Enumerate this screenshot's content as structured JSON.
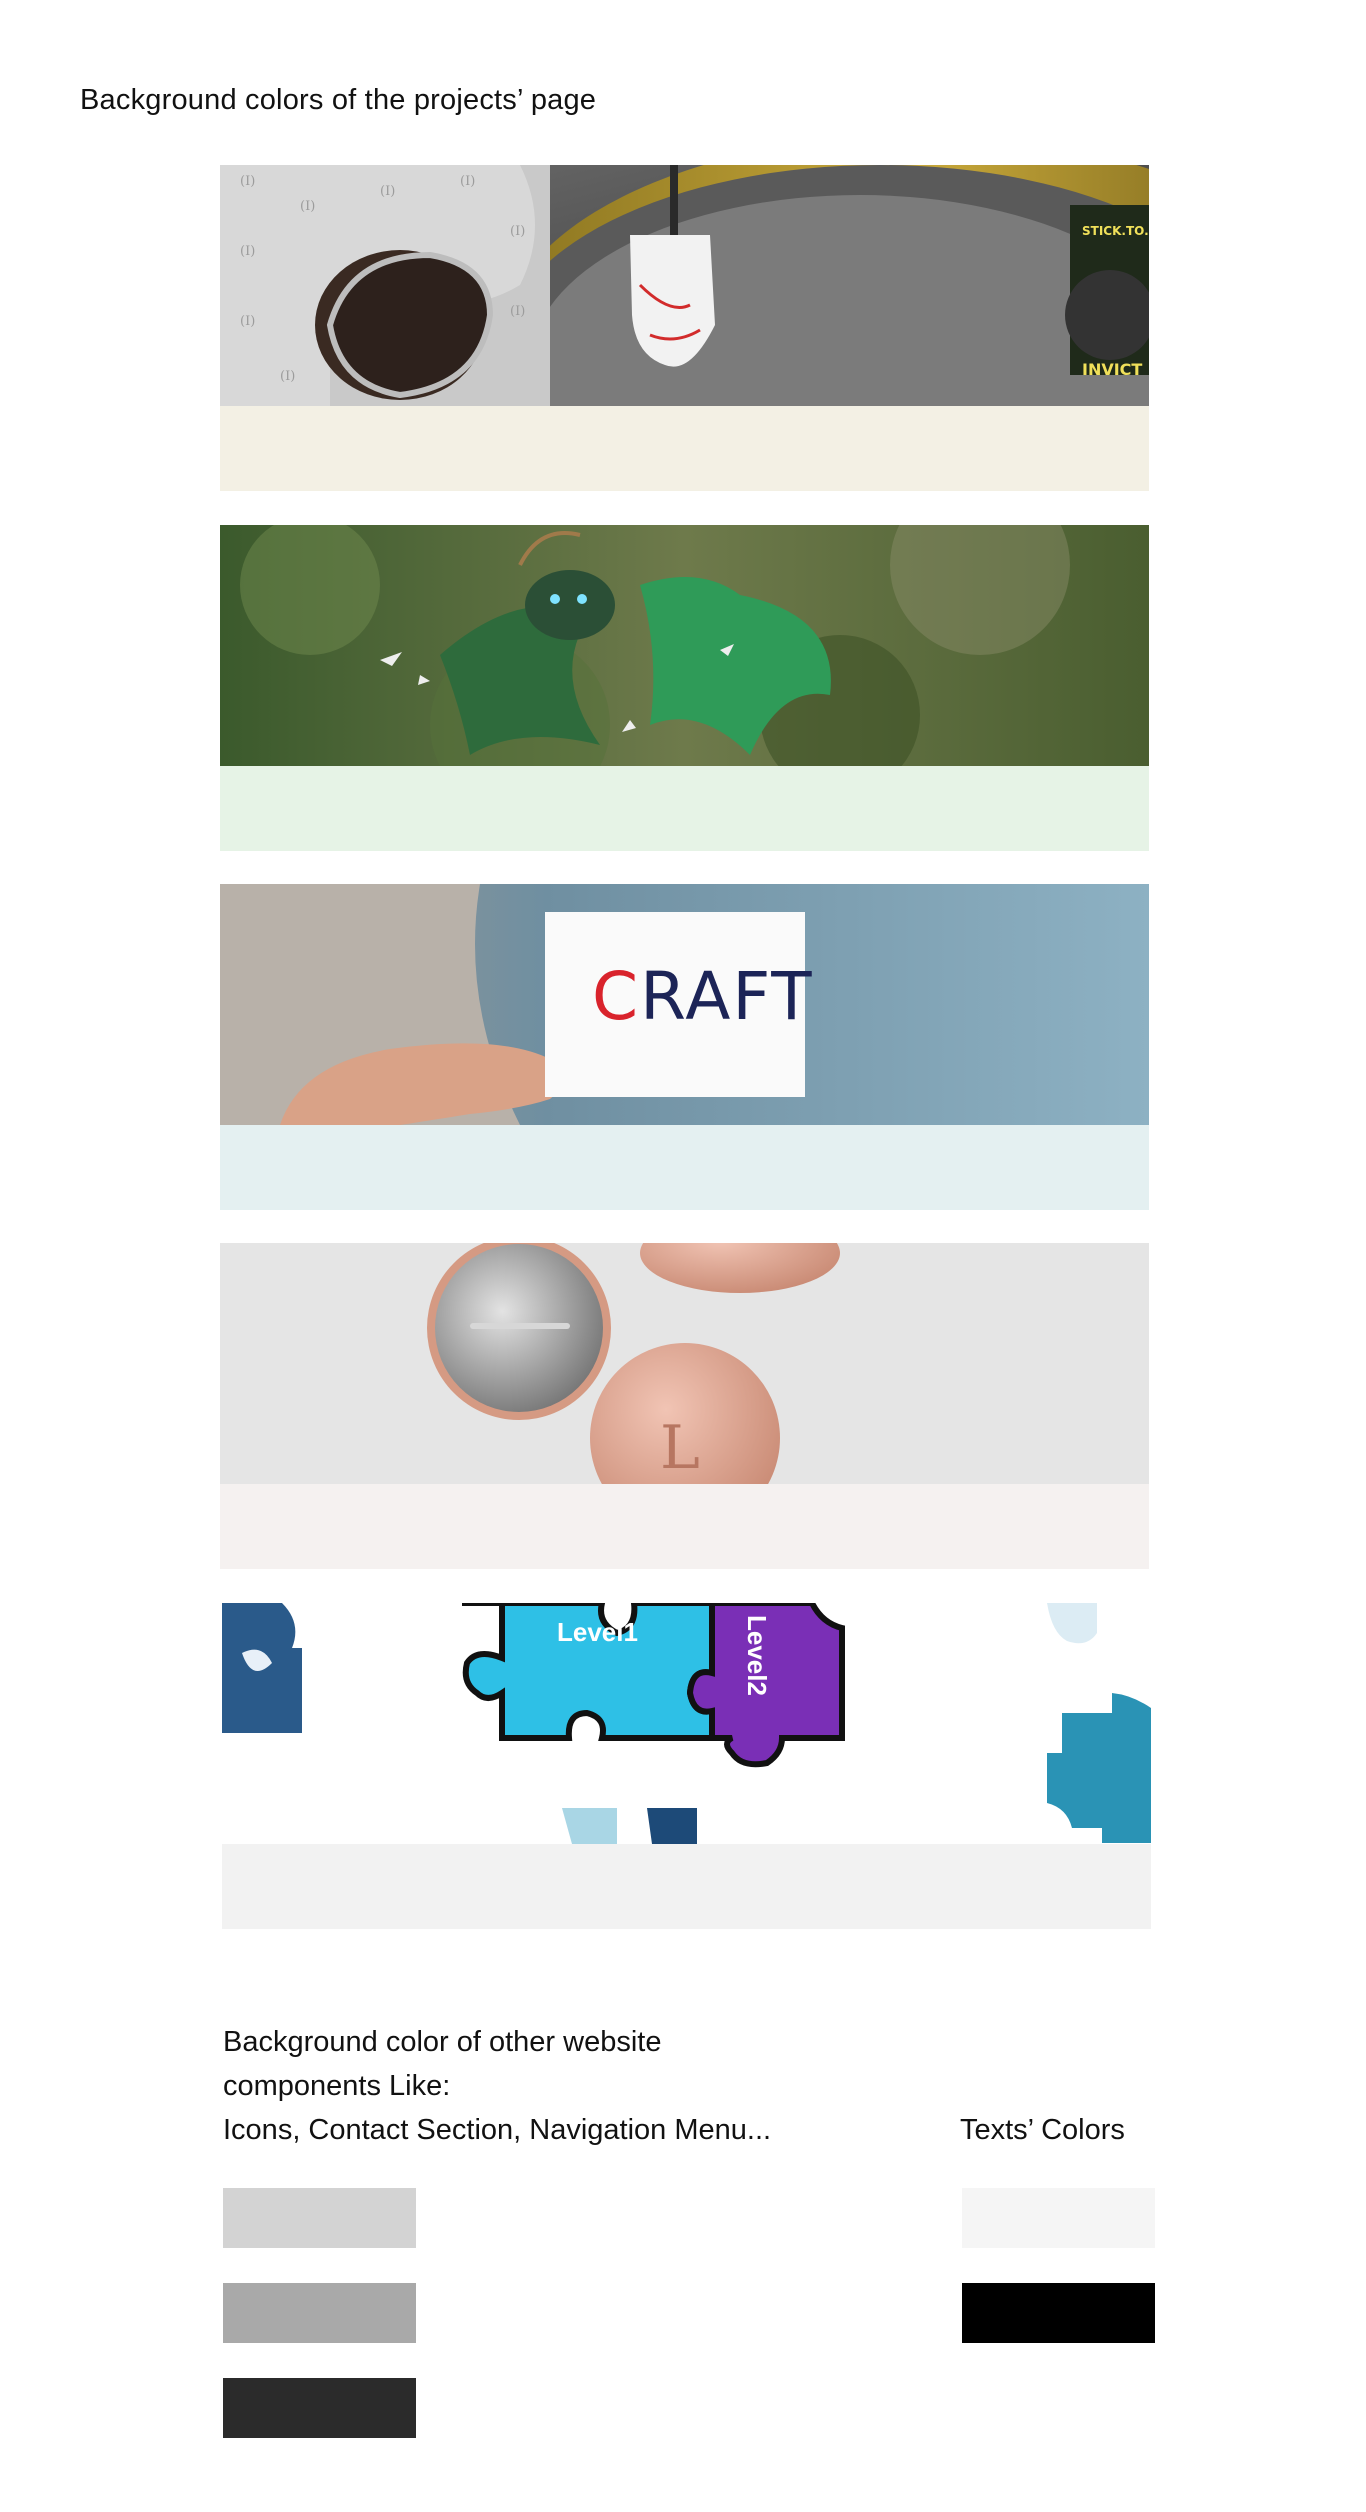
{
  "heading": "Background colors of the projects’ page",
  "projects": [
    {
      "name": "invictus",
      "bg_color": "#f3f0e4",
      "photo_desc_icon": "glove-icon"
    },
    {
      "name": "dragon",
      "bg_color": "#e6f3e6",
      "photo_desc_icon": "dragon-icon"
    },
    {
      "name": "craft",
      "bg_color": "#e4f0f1",
      "card_logo": "CRAFT",
      "photo_desc_icon": "business-card-icon"
    },
    {
      "name": "badges",
      "bg_color": "#f5f1f0",
      "photo_desc_icon": "pin-badge-icon"
    },
    {
      "name": "levels",
      "bg_color": "#f2f2f2",
      "puzzle_labels": [
        "Level1",
        "Level2"
      ],
      "photo_desc_icon": "puzzle-icon"
    }
  ],
  "other": {
    "lines": [
      "Background color of other website",
      "components Like:",
      "Icons, Contact Section, Navigation Menu..."
    ],
    "colors": [
      "#d3d3d3",
      "#a9a9a9",
      "#2b2b2b"
    ]
  },
  "texts": {
    "heading": "Texts’ Colors",
    "colors": [
      "#f5f5f5",
      "#000000"
    ]
  }
}
